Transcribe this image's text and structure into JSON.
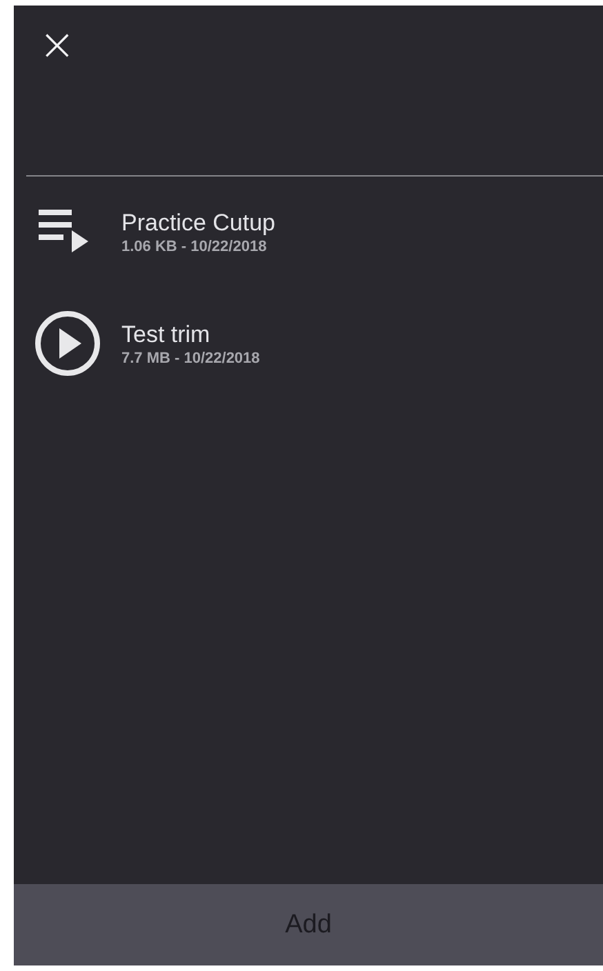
{
  "close_button": {
    "label": "×"
  },
  "files": [
    {
      "kind": "playlist",
      "title": "Practice Cutup",
      "details": "1.06 KB - 10/22/2018"
    },
    {
      "kind": "video",
      "title": "Test trim",
      "details": "7.7 MB - 10/22/2018"
    }
  ],
  "add_button": {
    "label": "Add",
    "disabled": true
  }
}
